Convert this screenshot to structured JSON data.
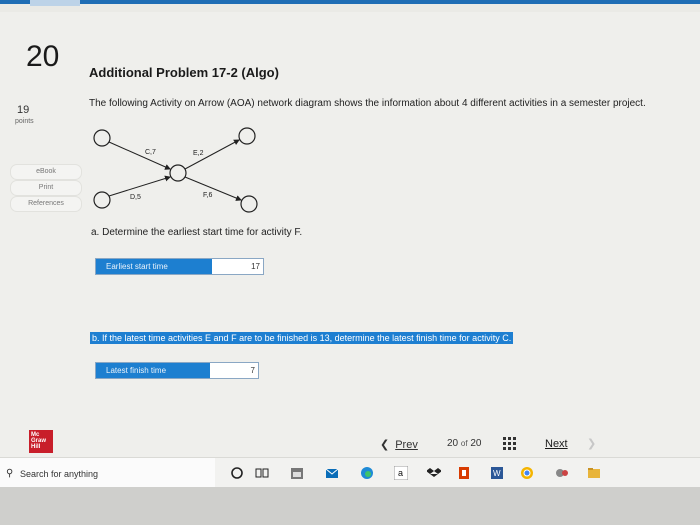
{
  "question": {
    "number": "20",
    "points": "19",
    "points_label": "points"
  },
  "sidebar": {
    "items": [
      {
        "label": "eBook"
      },
      {
        "label": "Print"
      },
      {
        "label": "References"
      }
    ]
  },
  "problem": {
    "title": "Additional Problem 17-2 (Algo)",
    "intro": "The following Activity on Arrow (AOA) network diagram shows the information about 4 different activities in a semester project.",
    "diagram": {
      "activity_labels": [
        "C,7",
        "E,2",
        "D,5",
        "F,6"
      ]
    },
    "part_a": {
      "prompt": "a. Determine the earliest start time for activity F.",
      "field_label": "Earliest start time",
      "value": "17"
    },
    "part_b": {
      "prompt": "b. If the latest time activities E and F are to be finished is 13, determine the latest finish time for activity C.",
      "field_label": "Latest finish time",
      "value": "7"
    }
  },
  "brand": {
    "logo_lines": [
      "Mc",
      "Graw",
      "Hill"
    ]
  },
  "navigation": {
    "prev_label": "Prev",
    "current": "20",
    "of_label": "of",
    "total": "20",
    "next_label": "Next"
  },
  "taskbar": {
    "search_placeholder": "Search for anything"
  },
  "colors": {
    "accent": "#1d7fd0",
    "logo": "#c81e2a"
  }
}
